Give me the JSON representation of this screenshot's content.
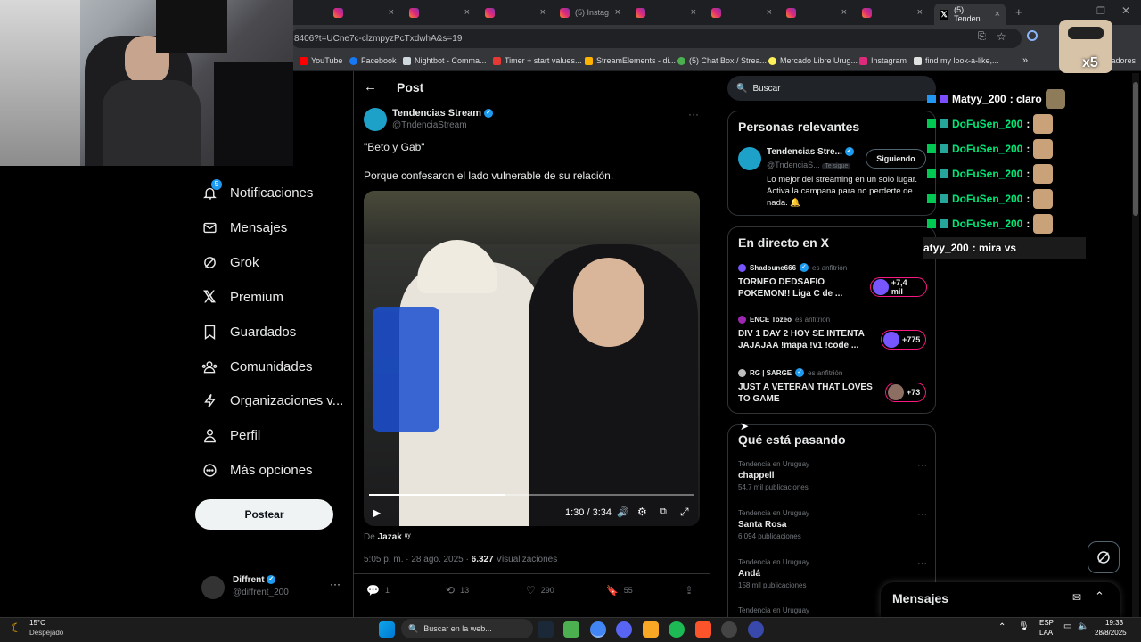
{
  "browser": {
    "active_tab_title": "(5) Tenden",
    "tab_labels": [
      "",
      "",
      "",
      "",
      "(5) Instag",
      "",
      "",
      "",
      "",
      ""
    ],
    "url": "8406?t=UCne7c-clzmpyzPcTxdwhA&s=19",
    "bookmarks": [
      "YouTube",
      "Facebook",
      "Nightbot - Comma...",
      "Timer + start values...",
      "StreamElements - di...",
      "(5) Chat Box / Strea...",
      "Mercado Libre Urug...",
      "Instagram",
      "find my look-a-like,..."
    ],
    "bookmarks_more": "»",
    "bookmarks_folder": "arcadores"
  },
  "nav": {
    "items": [
      {
        "label": "Notificaciones",
        "icon": "bell-icon",
        "badge": "5"
      },
      {
        "label": "Mensajes",
        "icon": "envelope-icon"
      },
      {
        "label": "Grok",
        "icon": "grok-icon"
      },
      {
        "label": "Premium",
        "icon": "x-logo-icon"
      },
      {
        "label": "Guardados",
        "icon": "bookmark-icon"
      },
      {
        "label": "Comunidades",
        "icon": "people-icon"
      },
      {
        "label": "Organizaciones v...",
        "icon": "lightning-icon"
      },
      {
        "label": "Perfil",
        "icon": "person-icon"
      },
      {
        "label": "Más opciones",
        "icon": "more-circle-icon"
      }
    ],
    "post_button": "Postear",
    "profile": {
      "name": "Diffrent",
      "handle": "@diffrent_200",
      "more": "···"
    }
  },
  "post": {
    "header": "Post",
    "author_name": "Tendencias Stream",
    "author_handle": "@TndenciaStream",
    "more": "···",
    "text_line1": "\"Beto y Gab\"",
    "text_line2": "Porque confesaron el lado vulnerable de su relación.",
    "video": {
      "time": "1:30 / 3:34",
      "progress": 0.42
    },
    "credit_prefix": "De",
    "credit_name": "Jazak",
    "credit_suffix": "ᵘʸ",
    "timestamp": "5:05 p. m. · 28 ago. 2025 ·",
    "views_count": "6.327",
    "views_label": "Visualizaciones",
    "actions": {
      "replies": "1",
      "reposts": "13",
      "likes": "290",
      "bookmarks": "55"
    }
  },
  "search": {
    "placeholder": "Buscar"
  },
  "relevant": {
    "title": "Personas relevantes",
    "name": "Tendencias Stre...",
    "handle": "@TndenciaS...",
    "follows_you": "Te sigue",
    "follow_button": "Siguiendo",
    "bio": "Lo mejor del streaming en un solo lugar. Activa la campana para no perderte de nada. 🔔"
  },
  "live": {
    "title": "En directo en X",
    "host_suffix": "es anfitrión",
    "items": [
      {
        "host": "Shadoune666",
        "title_line1": "TORNEO DEDSAFIO",
        "title_line2": "POKEMON!! Liga C de ...",
        "count": "+7,4 mil"
      },
      {
        "host": "ENCE Tozeo",
        "title_line1": "DIV 1 DAY 2 HOY SE INTENTA",
        "title_line2": "JAJAJAA !mapa !v1 !code ...",
        "count": "+775"
      },
      {
        "host": "RG | SARGE",
        "title_line1": "JUST A VETERAN THAT LOVES",
        "title_line2": "TO GAME",
        "count": "+73"
      }
    ]
  },
  "trends": {
    "title": "Qué está pasando",
    "items": [
      {
        "label": "Tendencia en Uruguay",
        "name": "chappell",
        "count": "54,7 mil publicaciones"
      },
      {
        "label": "Tendencia en Uruguay",
        "name": "Santa Rosa",
        "count": "6.094 publicaciones"
      },
      {
        "label": "Tendencia en Uruguay",
        "name": "Andá",
        "count": "158 mil publicaciones"
      },
      {
        "label": "Tendencia en Uruguay",
        "name": "",
        "count": ""
      }
    ]
  },
  "messages": {
    "title": "Mensajes"
  },
  "chat": {
    "lines": [
      {
        "user": "Matyy_200",
        "msg": ": claro"
      },
      {
        "user": "DoFuSen_200",
        "msg": ":"
      },
      {
        "user": "DoFuSen_200",
        "msg": ":"
      },
      {
        "user": "DoFuSen_200",
        "msg": ":"
      },
      {
        "user": "DoFuSen_200",
        "msg": ":"
      },
      {
        "user": "DoFuSen_200",
        "msg": ":"
      },
      {
        "user": "atyy_200",
        "msg": ": mira vs"
      }
    ],
    "multiplier": "x5"
  },
  "taskbar": {
    "weather_temp": "15°C",
    "weather_desc": "Despejado",
    "search_placeholder": "Buscar en la web...",
    "lang1": "ESP",
    "lang2": "LAA",
    "time": "19:33",
    "date": "28/8/2025"
  }
}
